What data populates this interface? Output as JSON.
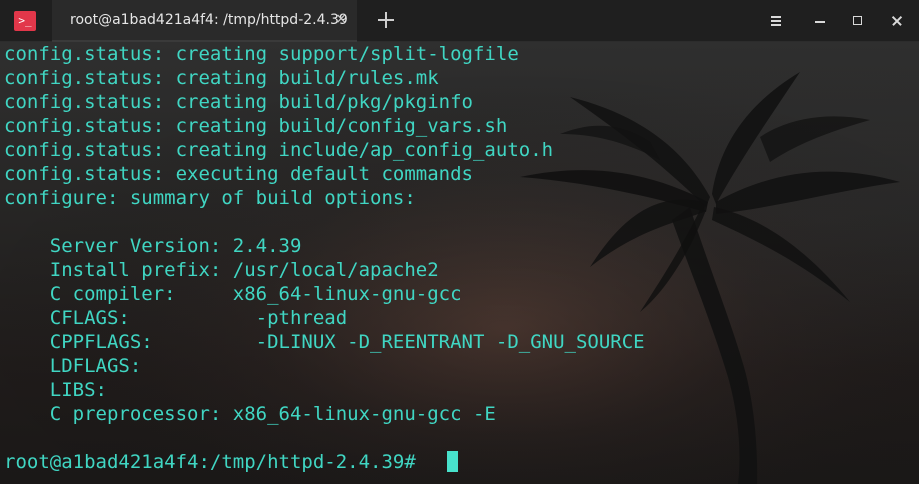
{
  "window": {
    "tab_title": "root@a1bad421a4f4: /tmp/httpd-2.4.39",
    "tab_close": "×",
    "new_tab_icon": "plus-icon",
    "app_icon": "terminal-app-icon",
    "app_icon_text": ">_",
    "controls": {
      "menu": "hamburger-icon",
      "minimize": "minimize-icon",
      "maximize": "maximize-icon",
      "close": "close-icon"
    }
  },
  "terminal": {
    "lines": [
      "config.status: creating support/split-logfile",
      "config.status: creating build/rules.mk",
      "config.status: creating build/pkg/pkginfo",
      "config.status: creating build/config_vars.sh",
      "config.status: creating include/ap_config_auto.h",
      "config.status: executing default commands",
      "configure: summary of build options:",
      "",
      "    Server Version: 2.4.39",
      "    Install prefix: /usr/local/apache2",
      "    C compiler:     x86_64-linux-gnu-gcc",
      "    CFLAGS:           -pthread",
      "    CPPFLAGS:         -DLINUX -D_REENTRANT -D_GNU_SOURCE",
      "    LDFLAGS:",
      "    LIBS:",
      "    C preprocessor: x86_64-linux-gnu-gcc -E",
      "",
      "root@a1bad421a4f4:/tmp/httpd-2.4.39# "
    ],
    "text_color": "#40d6c3",
    "cursor_color": "#48e1cb"
  },
  "theme": {
    "titlebar_bg": "#1f1f1f",
    "tab_bg": "#2a2a2a",
    "accent_red": "#e2374a"
  }
}
